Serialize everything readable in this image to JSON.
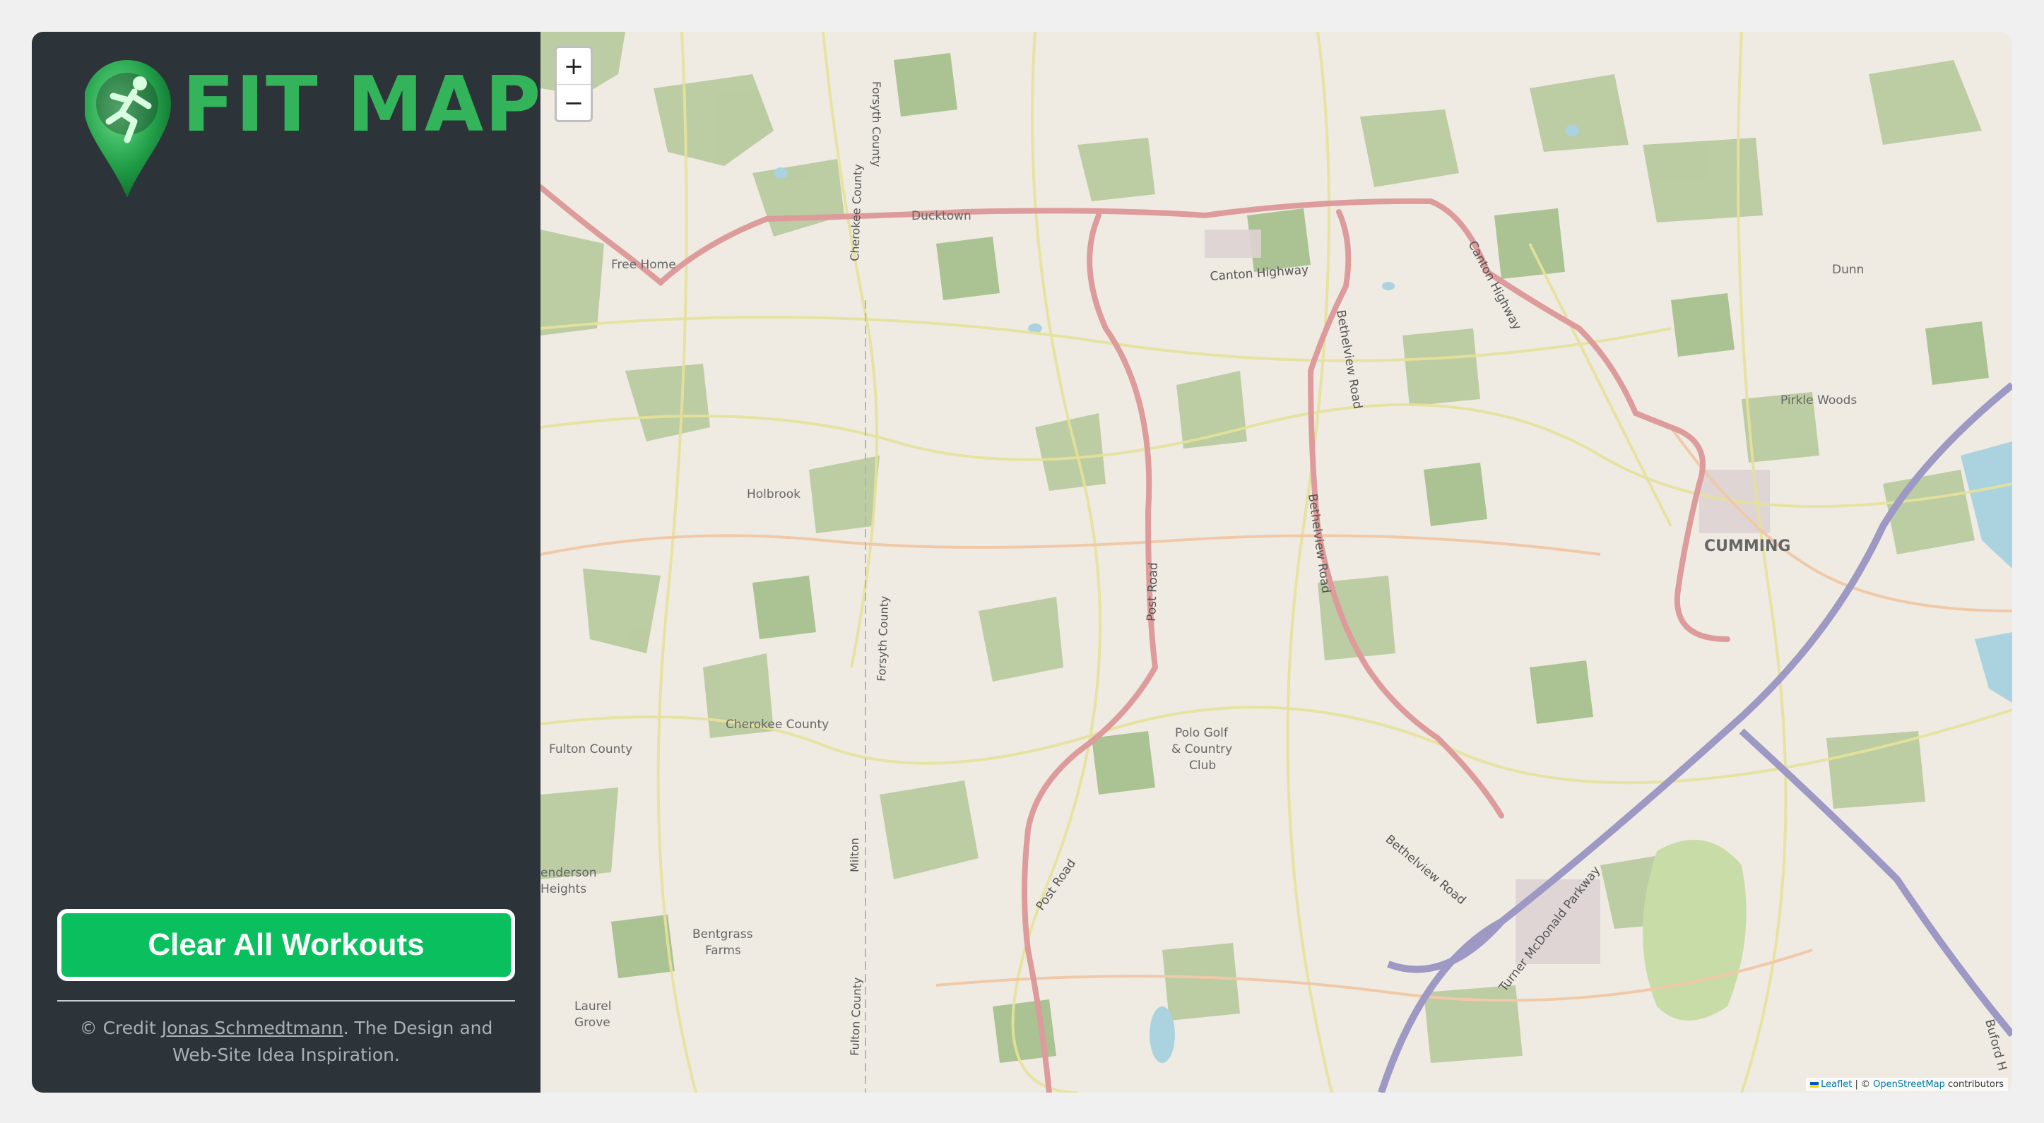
{
  "app": {
    "logo_text": "FIT MAP",
    "accent_color": "#33b35a",
    "logo_icon": "runner-map-pin-icon"
  },
  "sidebar": {
    "clear_button_label": "Clear All Workouts",
    "credit_prefix": "© Credit ",
    "credit_author": "Jonas Schmedtmann",
    "credit_suffix": ". The Design and Web-Site Idea Inspiration.",
    "background_color": "#2d3439",
    "button_color": "#0ac05e"
  },
  "map": {
    "zoom_in_label": "+",
    "zoom_out_label": "−",
    "attribution_leaflet": "Leaflet",
    "attribution_separator": " | © ",
    "attribution_osm": "OpenStreetMap",
    "attribution_suffix": " contributors",
    "place_labels": {
      "ducktown": "Ducktown",
      "free_home": "Free Home",
      "holbrook": "Holbrook",
      "cherokee_county": "Cherokee County",
      "fulton_county": "Fulton County",
      "henderson_heights_1": "enderson",
      "henderson_heights_2": "Heights",
      "bentgrass_1": "Bentgrass",
      "bentgrass_2": "Farms",
      "laurel_1": "Laurel",
      "laurel_2": "Grove",
      "polo_1": "Polo Golf",
      "polo_2": "& Country",
      "polo_3": "Club",
      "cumming": "CUMMING",
      "dunn": "Dunn",
      "pirkle_woods": "Pirkle Woods"
    },
    "road_labels": {
      "canton_highway": "Canton Highway",
      "bethelview_road": "Bethelview Road",
      "post_road": "Post Road",
      "forsyth_county": "Forsyth County",
      "cherokee_county_v": "Cherokee County",
      "milton": "Milton",
      "fulton_county_v": "Fulton County",
      "turner_mcdonald": "Turner McDonald Parkway",
      "buford_hwy": "Buford H"
    }
  }
}
